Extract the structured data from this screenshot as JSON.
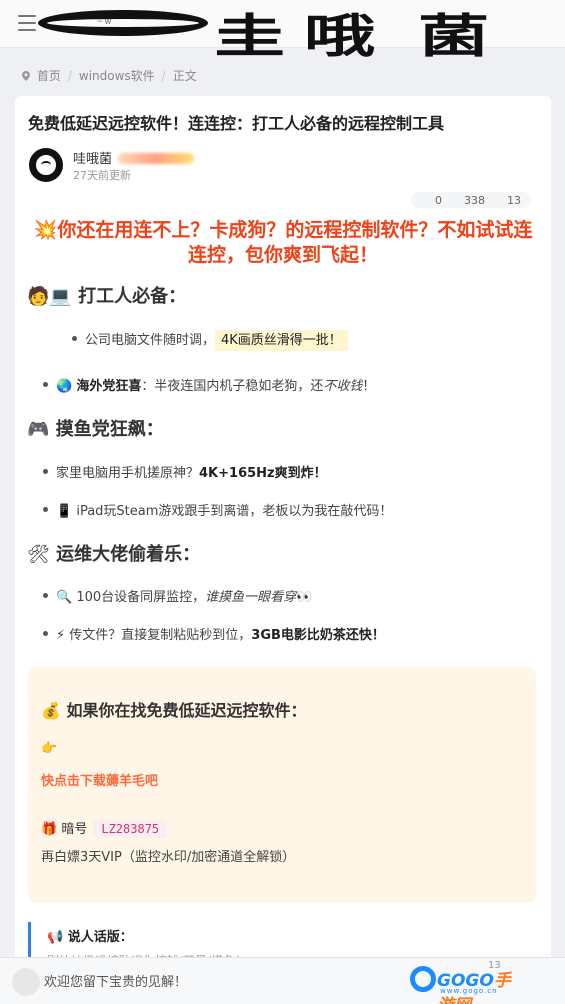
{
  "header": {
    "menu_icon": "hamburger-icon",
    "logo_text": "哇哦菌",
    "logo_o": "O",
    "logo_small": "~ w",
    "logo_chars": [
      "圭",
      "哦",
      "菌"
    ]
  },
  "breadcrumb": {
    "icon": "location-pin-icon",
    "items": [
      "首页",
      "windows软件",
      "正文"
    ]
  },
  "article": {
    "title": "免费低延迟远控软件！连连控：打工人必备的远程控制工具",
    "author": "哇哦菌",
    "updated": "27天前更新",
    "stats": {
      "comments": "0",
      "views": "338",
      "likes": "13"
    },
    "headline": "💥你还在用连不上？卡成狗？的远程控制软件？不如试试连连控，包你爽到飞起！",
    "section1": {
      "emoji": "🧑💻",
      "heading": "打工人必备：",
      "item1_text": "公司电脑文件随时调，",
      "item1_highlight": "4K画质丝滑得一批！",
      "item2_emoji": "🌏",
      "item2_bold": "海外党狂喜",
      "item2_text": "：半夜连国内机子稳如老狗，还",
      "item2_italic": "不收钱",
      "item2_end": "！"
    },
    "section2": {
      "emoji": "🎮",
      "heading": "摸鱼党狂飙：",
      "item1_text": "家里电脑用手机搓原神？",
      "item1_bold": "4K+165Hz爽到炸！",
      "item2_emoji": "📱",
      "item2_text": "iPad玩Steam游戏跟手到离谱，老板以为我在敲代码！"
    },
    "section3": {
      "emoji": "🛠",
      "heading": "运维大佬偷着乐：",
      "item1_emoji": "🔍",
      "item1_text": "100台设备同屏监控，",
      "item1_italic": "谁摸鱼一眼看穿",
      "item1_end": "👀",
      "item2_emoji": "⚡",
      "item2_text": "传文件？直接复制粘贴秒到位，",
      "item2_bold": "3GB电影比奶茶还快！"
    },
    "promo": {
      "emoji": "💰",
      "title": "如果你在找免费低延迟远控软件：",
      "hand_emoji": "👉",
      "link_text": "快点击下载薅羊毛吧",
      "code_emoji": "🎁",
      "code_label": "暗号",
      "code_value": "LZ283875",
      "vip_text": "再白嫖3天VIP（监控水印/加密通道全解锁）"
    },
    "quote": {
      "emoji": "📢",
      "title": "说人话版：",
      "text": "别让垃圾远控耽误你搞钱/开黑/摸鱼！"
    }
  },
  "bottom_bar": {
    "comment_placeholder": "欢迎您留下宝贵的见解！",
    "counter": "13",
    "watermark_main": "GOGO",
    "watermark_accent": "手游网",
    "watermark_sub": "www.gogo.cn"
  },
  "colors": {
    "headline": "#ee4318",
    "link": "#ff6a3d",
    "code": "#d6336c",
    "quote_border": "#2f80ed",
    "promo_bg": "#fff6e8"
  }
}
